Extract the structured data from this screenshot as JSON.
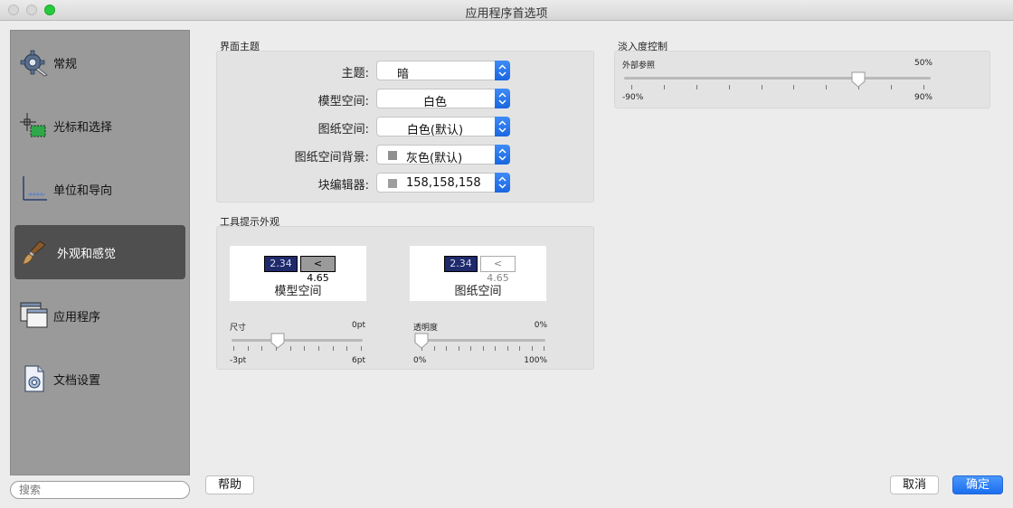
{
  "window": {
    "title": "应用程序首选项"
  },
  "sidebar": {
    "items": [
      {
        "label": "常规",
        "icon": "gear-wrench-icon"
      },
      {
        "label": "光标和选择",
        "icon": "crosshair-selection-icon"
      },
      {
        "label": "单位和导向",
        "icon": "axes-units-icon"
      },
      {
        "label": "外观和感觉",
        "icon": "brush-icon",
        "active": true
      },
      {
        "label": "应用程序",
        "icon": "windows-stack-icon"
      },
      {
        "label": "文档设置",
        "icon": "document-settings-icon"
      }
    ]
  },
  "search": {
    "placeholder": "搜索"
  },
  "theme_group": {
    "title": "界面主题",
    "rows": [
      {
        "label": "主题:",
        "value": "暗"
      },
      {
        "label": "模型空间:",
        "value": "白色"
      },
      {
        "label": "图纸空间:",
        "value": "白色(默认)"
      },
      {
        "label": "图纸空间背景:",
        "value": "灰色(默认)",
        "swatch": "#8f8f8f"
      },
      {
        "label": "块编辑器:",
        "value": "158,158,158",
        "swatch": "#9e9e9e"
      }
    ]
  },
  "tooltip_group": {
    "title": "工具提示外观",
    "model_preview": {
      "value": "2.34",
      "compare": "< 4.65",
      "label": "模型空间"
    },
    "paper_preview": {
      "value": "2.34",
      "compare": "< 4.65",
      "label": "图纸空间"
    },
    "size_slider": {
      "label": "尺寸",
      "current": "0pt",
      "min": "-3pt",
      "max": "6pt",
      "value": 0,
      "range": [
        -3,
        6
      ]
    },
    "transparency_slider": {
      "label": "透明度",
      "current": "0%",
      "min": "0%",
      "max": "100%",
      "value": 0,
      "range": [
        0,
        100
      ]
    }
  },
  "fade_group": {
    "title": "淡入度控制",
    "xref_slider": {
      "label": "外部参照",
      "current": "50%",
      "min": "-90%",
      "max": "90%",
      "value": 50,
      "range": [
        -90,
        90
      ]
    }
  },
  "buttons": {
    "help": "帮助",
    "cancel": "取消",
    "ok": "确定"
  },
  "colors": {
    "accent": "#1b6ff0",
    "sidebar_active": "#4f4f4f",
    "preview_dark": "#1f2a6b"
  }
}
